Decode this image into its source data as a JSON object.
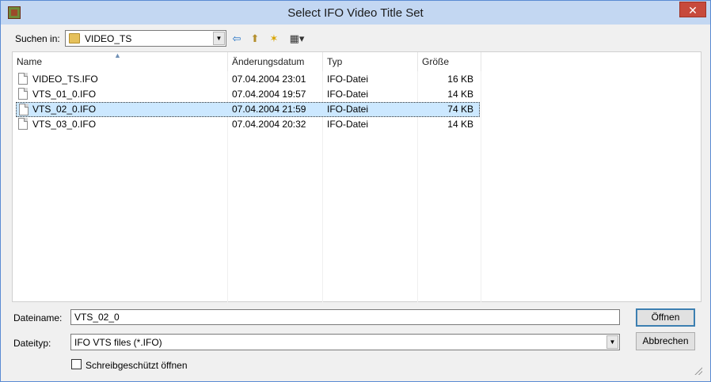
{
  "window": {
    "title": "Select IFO Video Title Set",
    "close_glyph": "✕"
  },
  "lookin": {
    "label": "Suchen in:",
    "value": "VIDEO_TS",
    "icon": "folder-icon"
  },
  "toolbar": {
    "back_glyph": "⇦",
    "up_glyph": "⬆",
    "newfolder_glyph": "✶",
    "view_glyph": "▦▾"
  },
  "columns": [
    {
      "label": "Name"
    },
    {
      "label": "Änderungsdatum"
    },
    {
      "label": "Typ"
    },
    {
      "label": "Größe"
    }
  ],
  "files": [
    {
      "name": "VIDEO_TS.IFO",
      "date": "07.04.2004 23:01",
      "type": "IFO-Datei",
      "size": "16 KB",
      "selected": false
    },
    {
      "name": "VTS_01_0.IFO",
      "date": "07.04.2004 19:57",
      "type": "IFO-Datei",
      "size": "14 KB",
      "selected": false
    },
    {
      "name": "VTS_02_0.IFO",
      "date": "07.04.2004 21:59",
      "type": "IFO-Datei",
      "size": "74 KB",
      "selected": true
    },
    {
      "name": "VTS_03_0.IFO",
      "date": "07.04.2004 20:32",
      "type": "IFO-Datei",
      "size": "14 KB",
      "selected": false
    }
  ],
  "filename": {
    "label": "Dateiname:",
    "value": "VTS_02_0"
  },
  "filetype": {
    "label": "Dateityp:",
    "value": "IFO VTS files (*.IFO)"
  },
  "readonly": {
    "label": "Schreibgeschützt öffnen",
    "checked": false
  },
  "buttons": {
    "open": "Öffnen",
    "cancel": "Abbrechen"
  }
}
